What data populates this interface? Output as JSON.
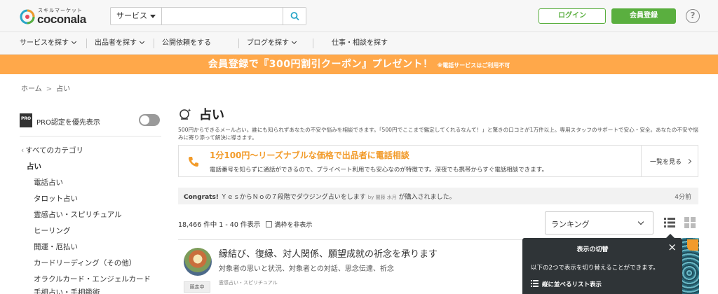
{
  "header": {
    "logo_sub": "スキルマーケット",
    "logo_text": "coconala",
    "search_category": "サービス",
    "search_placeholder": "",
    "login_label": "ログイン",
    "register_label": "会員登録",
    "help_label": "?"
  },
  "nav": {
    "items": [
      {
        "label": "サービスを探す"
      },
      {
        "label": "出品者を探す"
      },
      {
        "label": "公開依頼をする"
      },
      {
        "label": "ブログを探す"
      },
      {
        "label": "仕事・相談を探す"
      }
    ]
  },
  "banner": {
    "main": "会員登録で『300円割引クーポン』プレゼント！",
    "note": "※電話サービスはご利用不可"
  },
  "breadcrumb": {
    "home": "ホーム",
    "sep": ">",
    "current": "占い"
  },
  "sidebar": {
    "pro_badge": "PRO",
    "pro_label": "PRO認定を優先表示",
    "all_categories": "すべてのカテゴリ",
    "current_category": "占い",
    "items": [
      "電話占い",
      "タロット占い",
      "霊感占い・スピリチュアル",
      "ヒーリング",
      "開運・厄払い",
      "カードリーディング（その他）",
      "オラクルカード・エンジェルカード",
      "手相占い・手相鑑術"
    ]
  },
  "main": {
    "title": "占い",
    "description": "500円からできるメール占い。誰にも知られずあなたの不安や悩みを相談できます。「500円でここまで鑑定してくれるなんて！」と驚きの口コミが1万件以上。専用スタッフのサポートで安心・安全。あなたの不安や悩みに寄り添って解決に導きます。",
    "phone": {
      "title": "1分100円～リーズナブルな価格で出品者に電話相談",
      "desc": "電話番号を知らずに通話ができるので、プライベート利用でも安心なのが特徴です。深夜でも携帯からすぐ電話相談できます。",
      "link": "一覧を見る"
    },
    "congrats": {
      "prefix": "Congrats!",
      "item": "ＹｅｓからＮｏの７段階でダウジング占いをします",
      "by": "by 闇藤 水月",
      "suffix": "が購入されました。",
      "time": "4分前"
    },
    "results": {
      "count": "18,466 件中 1 - 40 件表示",
      "hide_full": "満枠を非表示"
    },
    "sort": {
      "selected": "ランキング"
    },
    "listing": {
      "title": "縁結び、復縁、対人関係、願望成就の祈念を承ります",
      "subtitle": "対象者の思いと状況、対象者との対話、思念伝達、祈念",
      "status": "競走中",
      "category": "霊感占い・スピリチュアル"
    }
  },
  "popover": {
    "title": "表示の切替",
    "close": "×",
    "text": "以下の2つで表示を切り替えることができます。",
    "option": "縦に並べるリスト表示"
  },
  "colors": {
    "accent_green": "#5aaf3f",
    "banner_orange": "#ffa84a",
    "phone_orange": "#f29b2a"
  }
}
